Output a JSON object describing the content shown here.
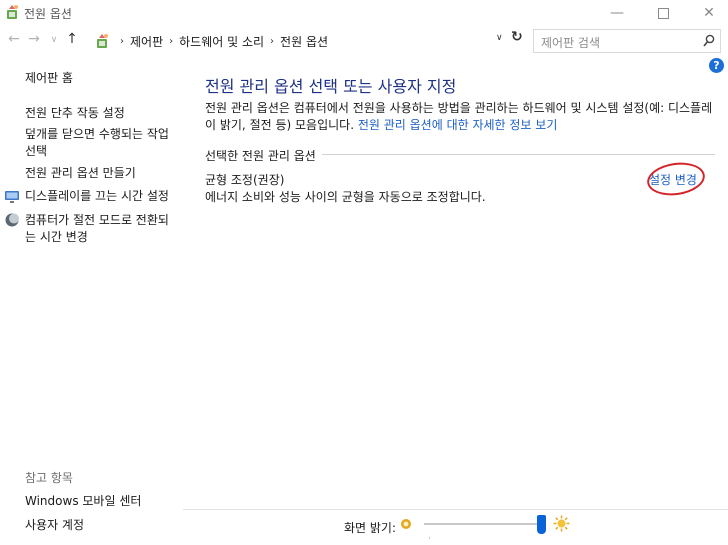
{
  "window": {
    "title": "전원 옵션",
    "minimize_glyph": "—",
    "close_glyph": "✕"
  },
  "nav": {
    "back_glyph": "←",
    "forward_glyph": "→",
    "recent_glyph": "∨",
    "up_glyph": "↑",
    "breadcrumbs": [
      "제어판",
      "하드웨어 및 소리",
      "전원 옵션"
    ],
    "crumb_separator": "›",
    "dropdown_glyph": "∨",
    "refresh_glyph": "↻",
    "search_placeholder": "제어판 검색"
  },
  "help": {
    "glyph": "?"
  },
  "sidebar": {
    "home": "제어판 홈",
    "links": [
      "전원 단추 작동 설정",
      "덮개를 닫으면 수행되는 작업 선택",
      "전원 관리 옵션 만들기",
      "디스플레이를 끄는 시간 설정",
      "컴퓨터가 절전 모드로 전환되는 시간 변경"
    ],
    "see_also_title": "참고 항목",
    "see_also": [
      "Windows 모바일 센터",
      "사용자 계정"
    ]
  },
  "main": {
    "title": "전원 관리 옵션 선택 또는 사용자 지정",
    "description": "전원 관리 옵션은 컴퓨터에서 전원을 사용하는 방법을 관리하는 하드웨어 및 시스템 설정(예: 디스플레이 밝기, 절전 등) 모음입니다.",
    "description_link": "전원 관리 옵션에 대한 자세한 정보 보기",
    "section_label": "선택한 전원 관리 옵션",
    "plan": {
      "name": "균형 조정(권장)",
      "description": "에너지 소비와 성능 사이의 균형을 자동으로 조정합니다.",
      "change_link": "설정 변경"
    }
  },
  "footer": {
    "brightness_label": "화면 밝기:",
    "brightness_level_fraction": 1.0
  },
  "colors": {
    "title_blue": "#1e3287",
    "link_blue": "#1c5fc5",
    "highlight_red": "#d3242a",
    "slider_blue": "#0a64d8"
  },
  "icons": {
    "app": "power-options-icon",
    "address": "control-panel-icon",
    "search": "search-icon",
    "display": "display-icon",
    "sleep": "sleep-moon-icon",
    "brightness_low": "brightness-low-icon",
    "brightness_high": "brightness-high-icon"
  }
}
